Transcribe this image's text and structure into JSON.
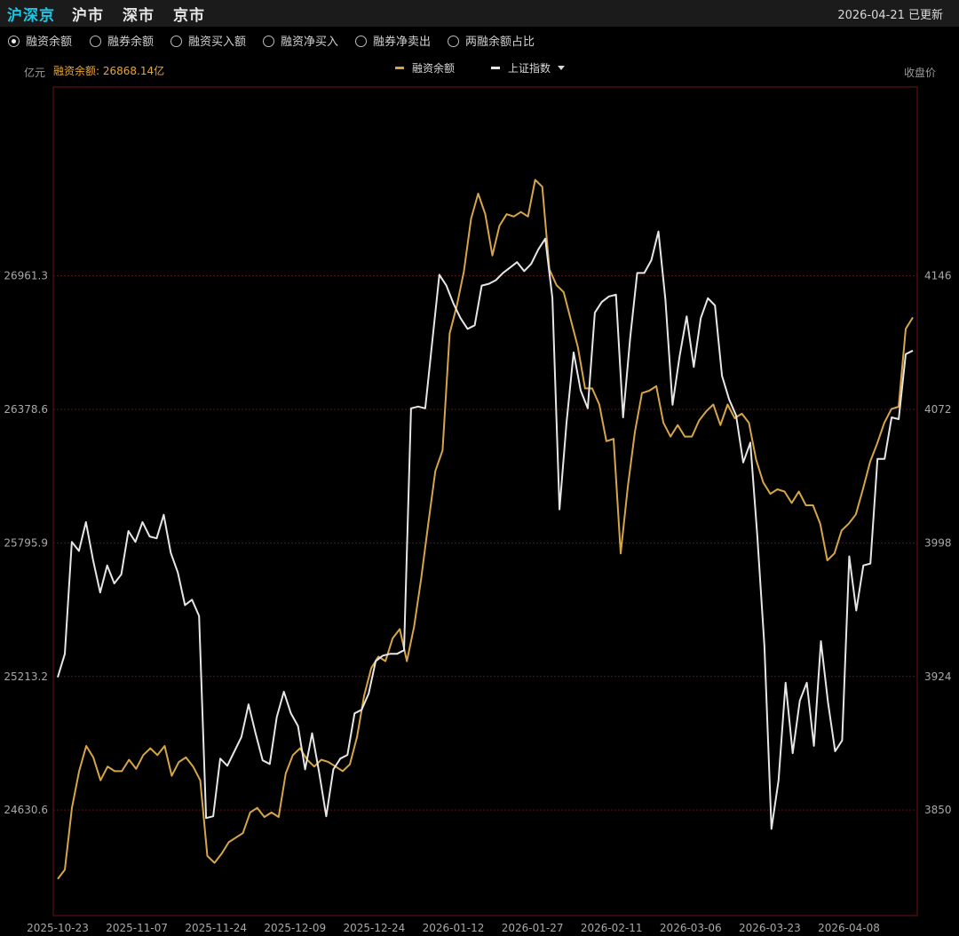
{
  "header": {
    "tabs": [
      {
        "label": "沪深京",
        "active": true
      },
      {
        "label": "沪市",
        "active": false
      },
      {
        "label": "深市",
        "active": false
      },
      {
        "label": "京市",
        "active": false
      }
    ],
    "update_text": "2026-04-21 已更新"
  },
  "options": [
    {
      "label": "融资余额",
      "selected": true
    },
    {
      "label": "融券余额",
      "selected": false
    },
    {
      "label": "融资买入额",
      "selected": false
    },
    {
      "label": "融资净买入",
      "selected": false
    },
    {
      "label": "融券净卖出",
      "selected": false
    },
    {
      "label": "两融余额占比",
      "selected": false
    }
  ],
  "chart_meta": {
    "left_unit": "亿元",
    "current_value_label": "融资余额: 26868.14亿",
    "right_unit": "收盘价",
    "legend": [
      {
        "label": "融资余额",
        "color": "#d6a646"
      },
      {
        "label": "上证指数",
        "color": "#e6e6e6",
        "dropdown": true
      }
    ]
  },
  "chart_data": {
    "type": "line",
    "x_labels": [
      "2025-10-23",
      "2025-11-07",
      "2025-11-24",
      "2025-12-09",
      "2025-12-24",
      "2026-01-12",
      "2026-01-27",
      "2026-02-11",
      "2026-03-06",
      "2026-03-23",
      "2026-04-08"
    ],
    "y_left_ticks": [
      "26961.3",
      "26378.6",
      "25795.9",
      "25213.2",
      "24630.6"
    ],
    "y_right_ticks": [
      "4146",
      "4072",
      "3998",
      "3924",
      "3850"
    ],
    "y_left_range": [
      24170,
      27785
    ],
    "y_right_range": [
      3791,
      4250
    ],
    "series": [
      {
        "name": "融资余额",
        "axis": "left",
        "color": "#d6a646",
        "values": [
          24330,
          24370,
          24640,
          24800,
          24910,
          24860,
          24760,
          24820,
          24800,
          24800,
          24850,
          24810,
          24870,
          24900,
          24870,
          24910,
          24780,
          24840,
          24860,
          24820,
          24760,
          24430,
          24400,
          24440,
          24490,
          24510,
          24530,
          24620,
          24640,
          24600,
          24620,
          24600,
          24790,
          24870,
          24900,
          24850,
          24820,
          24850,
          24840,
          24820,
          24800,
          24830,
          24950,
          25130,
          25250,
          25300,
          25280,
          25380,
          25420,
          25280,
          25430,
          25640,
          25880,
          26110,
          26200,
          26710,
          26830,
          26980,
          27210,
          27320,
          27230,
          27050,
          27180,
          27230,
          27220,
          27240,
          27220,
          27380,
          27350,
          26990,
          26920,
          26890,
          26770,
          26650,
          26470,
          26470,
          26400,
          26240,
          26250,
          25750,
          26040,
          26280,
          26450,
          26460,
          26480,
          26320,
          26260,
          26310,
          26260,
          26260,
          26330,
          26370,
          26400,
          26310,
          26400,
          26340,
          26360,
          26320,
          26160,
          26060,
          26010,
          26030,
          26020,
          25970,
          26020,
          25960,
          25960,
          25880,
          25720,
          25750,
          25850,
          25880,
          25920,
          26030,
          26150,
          26230,
          26320,
          26380,
          26390,
          26730,
          26780
        ],
        "last_value": 26868.14
      },
      {
        "name": "上证指数",
        "axis": "right",
        "color": "#e6e6e6",
        "values": [
          3923,
          3936,
          3998,
          3993,
          4009,
          3988,
          3970,
          3985,
          3975,
          3980,
          4004,
          3998,
          4009,
          4001,
          4000,
          4013,
          3992,
          3981,
          3963,
          3966,
          3957,
          3845,
          3846,
          3878,
          3874,
          3882,
          3890,
          3908,
          3892,
          3877,
          3875,
          3901,
          3915,
          3903,
          3896,
          3872,
          3892,
          3870,
          3846,
          3872,
          3878,
          3880,
          3903,
          3905,
          3914,
          3932,
          3935,
          3936,
          3936,
          3938,
          4072,
          4073,
          4072,
          4109,
          4146,
          4140,
          4130,
          4122,
          4116,
          4118,
          4140,
          4141,
          4143,
          4147,
          4150,
          4153,
          4148,
          4152,
          4160,
          4166,
          4133,
          4016,
          4064,
          4103,
          4082,
          4072,
          4125,
          4131,
          4134,
          4135,
          4067,
          4111,
          4147,
          4147,
          4154,
          4170,
          4132,
          4074,
          4101,
          4123,
          4095,
          4122,
          4133,
          4129,
          4090,
          4077,
          4068,
          4042,
          4053,
          4001,
          3940,
          3839,
          3866,
          3920,
          3881,
          3910,
          3920,
          3885,
          3943,
          3909,
          3882,
          3888,
          3990,
          3960,
          3985,
          3986,
          4044,
          4044,
          4067,
          4066,
          4102,
          4104
        ],
        "last_value": 4104
      }
    ],
    "grid": true,
    "legend_position": "top-center"
  }
}
